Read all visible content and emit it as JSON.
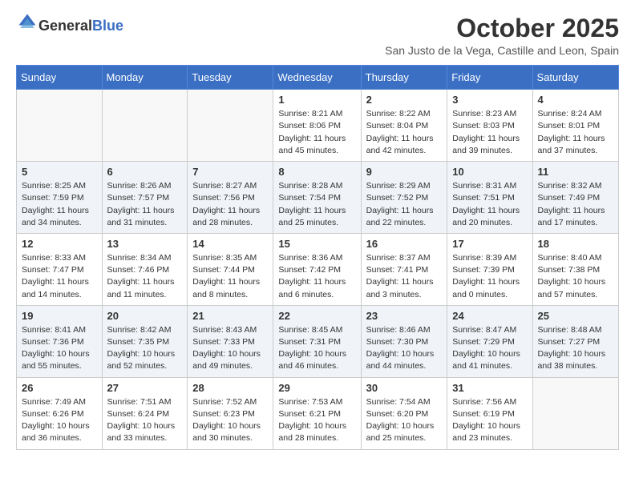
{
  "header": {
    "logo_general": "General",
    "logo_blue": "Blue",
    "title": "October 2025",
    "subtitle": "San Justo de la Vega, Castille and Leon, Spain"
  },
  "days_of_week": [
    "Sunday",
    "Monday",
    "Tuesday",
    "Wednesday",
    "Thursday",
    "Friday",
    "Saturday"
  ],
  "weeks": [
    [
      {
        "day": "",
        "sunrise": "",
        "sunset": "",
        "daylight": "",
        "empty": true
      },
      {
        "day": "",
        "sunrise": "",
        "sunset": "",
        "daylight": "",
        "empty": true
      },
      {
        "day": "",
        "sunrise": "",
        "sunset": "",
        "daylight": "",
        "empty": true
      },
      {
        "day": "1",
        "sunrise": "Sunrise: 8:21 AM",
        "sunset": "Sunset: 8:06 PM",
        "daylight": "Daylight: 11 hours and 45 minutes.",
        "empty": false
      },
      {
        "day": "2",
        "sunrise": "Sunrise: 8:22 AM",
        "sunset": "Sunset: 8:04 PM",
        "daylight": "Daylight: 11 hours and 42 minutes.",
        "empty": false
      },
      {
        "day": "3",
        "sunrise": "Sunrise: 8:23 AM",
        "sunset": "Sunset: 8:03 PM",
        "daylight": "Daylight: 11 hours and 39 minutes.",
        "empty": false
      },
      {
        "day": "4",
        "sunrise": "Sunrise: 8:24 AM",
        "sunset": "Sunset: 8:01 PM",
        "daylight": "Daylight: 11 hours and 37 minutes.",
        "empty": false
      }
    ],
    [
      {
        "day": "5",
        "sunrise": "Sunrise: 8:25 AM",
        "sunset": "Sunset: 7:59 PM",
        "daylight": "Daylight: 11 hours and 34 minutes.",
        "empty": false
      },
      {
        "day": "6",
        "sunrise": "Sunrise: 8:26 AM",
        "sunset": "Sunset: 7:57 PM",
        "daylight": "Daylight: 11 hours and 31 minutes.",
        "empty": false
      },
      {
        "day": "7",
        "sunrise": "Sunrise: 8:27 AM",
        "sunset": "Sunset: 7:56 PM",
        "daylight": "Daylight: 11 hours and 28 minutes.",
        "empty": false
      },
      {
        "day": "8",
        "sunrise": "Sunrise: 8:28 AM",
        "sunset": "Sunset: 7:54 PM",
        "daylight": "Daylight: 11 hours and 25 minutes.",
        "empty": false
      },
      {
        "day": "9",
        "sunrise": "Sunrise: 8:29 AM",
        "sunset": "Sunset: 7:52 PM",
        "daylight": "Daylight: 11 hours and 22 minutes.",
        "empty": false
      },
      {
        "day": "10",
        "sunrise": "Sunrise: 8:31 AM",
        "sunset": "Sunset: 7:51 PM",
        "daylight": "Daylight: 11 hours and 20 minutes.",
        "empty": false
      },
      {
        "day": "11",
        "sunrise": "Sunrise: 8:32 AM",
        "sunset": "Sunset: 7:49 PM",
        "daylight": "Daylight: 11 hours and 17 minutes.",
        "empty": false
      }
    ],
    [
      {
        "day": "12",
        "sunrise": "Sunrise: 8:33 AM",
        "sunset": "Sunset: 7:47 PM",
        "daylight": "Daylight: 11 hours and 14 minutes.",
        "empty": false
      },
      {
        "day": "13",
        "sunrise": "Sunrise: 8:34 AM",
        "sunset": "Sunset: 7:46 PM",
        "daylight": "Daylight: 11 hours and 11 minutes.",
        "empty": false
      },
      {
        "day": "14",
        "sunrise": "Sunrise: 8:35 AM",
        "sunset": "Sunset: 7:44 PM",
        "daylight": "Daylight: 11 hours and 8 minutes.",
        "empty": false
      },
      {
        "day": "15",
        "sunrise": "Sunrise: 8:36 AM",
        "sunset": "Sunset: 7:42 PM",
        "daylight": "Daylight: 11 hours and 6 minutes.",
        "empty": false
      },
      {
        "day": "16",
        "sunrise": "Sunrise: 8:37 AM",
        "sunset": "Sunset: 7:41 PM",
        "daylight": "Daylight: 11 hours and 3 minutes.",
        "empty": false
      },
      {
        "day": "17",
        "sunrise": "Sunrise: 8:39 AM",
        "sunset": "Sunset: 7:39 PM",
        "daylight": "Daylight: 11 hours and 0 minutes.",
        "empty": false
      },
      {
        "day": "18",
        "sunrise": "Sunrise: 8:40 AM",
        "sunset": "Sunset: 7:38 PM",
        "daylight": "Daylight: 10 hours and 57 minutes.",
        "empty": false
      }
    ],
    [
      {
        "day": "19",
        "sunrise": "Sunrise: 8:41 AM",
        "sunset": "Sunset: 7:36 PM",
        "daylight": "Daylight: 10 hours and 55 minutes.",
        "empty": false
      },
      {
        "day": "20",
        "sunrise": "Sunrise: 8:42 AM",
        "sunset": "Sunset: 7:35 PM",
        "daylight": "Daylight: 10 hours and 52 minutes.",
        "empty": false
      },
      {
        "day": "21",
        "sunrise": "Sunrise: 8:43 AM",
        "sunset": "Sunset: 7:33 PM",
        "daylight": "Daylight: 10 hours and 49 minutes.",
        "empty": false
      },
      {
        "day": "22",
        "sunrise": "Sunrise: 8:45 AM",
        "sunset": "Sunset: 7:31 PM",
        "daylight": "Daylight: 10 hours and 46 minutes.",
        "empty": false
      },
      {
        "day": "23",
        "sunrise": "Sunrise: 8:46 AM",
        "sunset": "Sunset: 7:30 PM",
        "daylight": "Daylight: 10 hours and 44 minutes.",
        "empty": false
      },
      {
        "day": "24",
        "sunrise": "Sunrise: 8:47 AM",
        "sunset": "Sunset: 7:29 PM",
        "daylight": "Daylight: 10 hours and 41 minutes.",
        "empty": false
      },
      {
        "day": "25",
        "sunrise": "Sunrise: 8:48 AM",
        "sunset": "Sunset: 7:27 PM",
        "daylight": "Daylight: 10 hours and 38 minutes.",
        "empty": false
      }
    ],
    [
      {
        "day": "26",
        "sunrise": "Sunrise: 7:49 AM",
        "sunset": "Sunset: 6:26 PM",
        "daylight": "Daylight: 10 hours and 36 minutes.",
        "empty": false
      },
      {
        "day": "27",
        "sunrise": "Sunrise: 7:51 AM",
        "sunset": "Sunset: 6:24 PM",
        "daylight": "Daylight: 10 hours and 33 minutes.",
        "empty": false
      },
      {
        "day": "28",
        "sunrise": "Sunrise: 7:52 AM",
        "sunset": "Sunset: 6:23 PM",
        "daylight": "Daylight: 10 hours and 30 minutes.",
        "empty": false
      },
      {
        "day": "29",
        "sunrise": "Sunrise: 7:53 AM",
        "sunset": "Sunset: 6:21 PM",
        "daylight": "Daylight: 10 hours and 28 minutes.",
        "empty": false
      },
      {
        "day": "30",
        "sunrise": "Sunrise: 7:54 AM",
        "sunset": "Sunset: 6:20 PM",
        "daylight": "Daylight: 10 hours and 25 minutes.",
        "empty": false
      },
      {
        "day": "31",
        "sunrise": "Sunrise: 7:56 AM",
        "sunset": "Sunset: 6:19 PM",
        "daylight": "Daylight: 10 hours and 23 minutes.",
        "empty": false
      },
      {
        "day": "",
        "sunrise": "",
        "sunset": "",
        "daylight": "",
        "empty": true
      }
    ]
  ]
}
